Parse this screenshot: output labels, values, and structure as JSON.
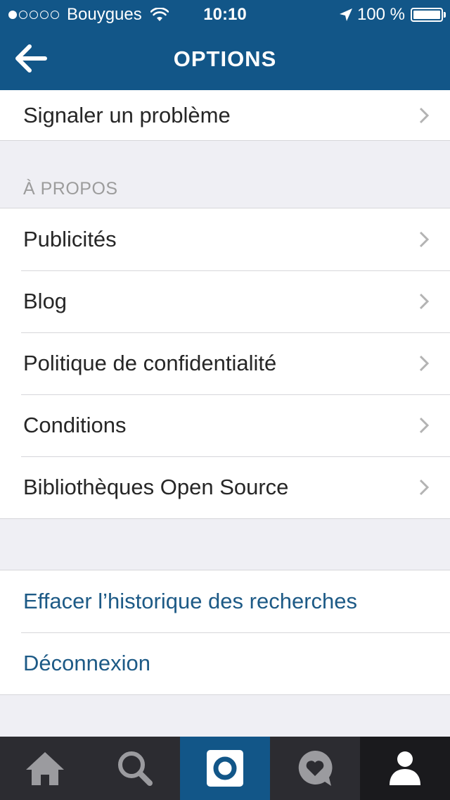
{
  "status_bar": {
    "carrier": "Bouygues",
    "time": "10:10",
    "battery": "100 %",
    "signal_bars": 1,
    "battery_level": 1.0
  },
  "nav": {
    "title": "OPTIONS",
    "back_icon": "arrow-left-icon"
  },
  "sections": {
    "top": {
      "items": [
        {
          "label": "Signaler un problème"
        }
      ]
    },
    "about": {
      "header": "À PROPOS",
      "items": [
        {
          "label": "Publicités"
        },
        {
          "label": "Blog"
        },
        {
          "label": "Politique de confidentialité"
        },
        {
          "label": "Conditions"
        },
        {
          "label": "Bibliothèques Open Source"
        }
      ]
    },
    "actions": {
      "items": [
        {
          "label": "Effacer l’historique des recherches"
        },
        {
          "label": "Déconnexion"
        }
      ]
    }
  },
  "tab_bar": {
    "tabs": [
      {
        "icon": "home-icon"
      },
      {
        "icon": "search-icon"
      },
      {
        "icon": "camera-icon",
        "selected": true
      },
      {
        "icon": "activity-heart-icon"
      },
      {
        "icon": "profile-icon"
      }
    ]
  },
  "colors": {
    "brand_blue": "#125688",
    "link_blue": "#1d5a86",
    "tabbar_bg": "#2c2c31",
    "section_header": "#9c9c9c"
  }
}
